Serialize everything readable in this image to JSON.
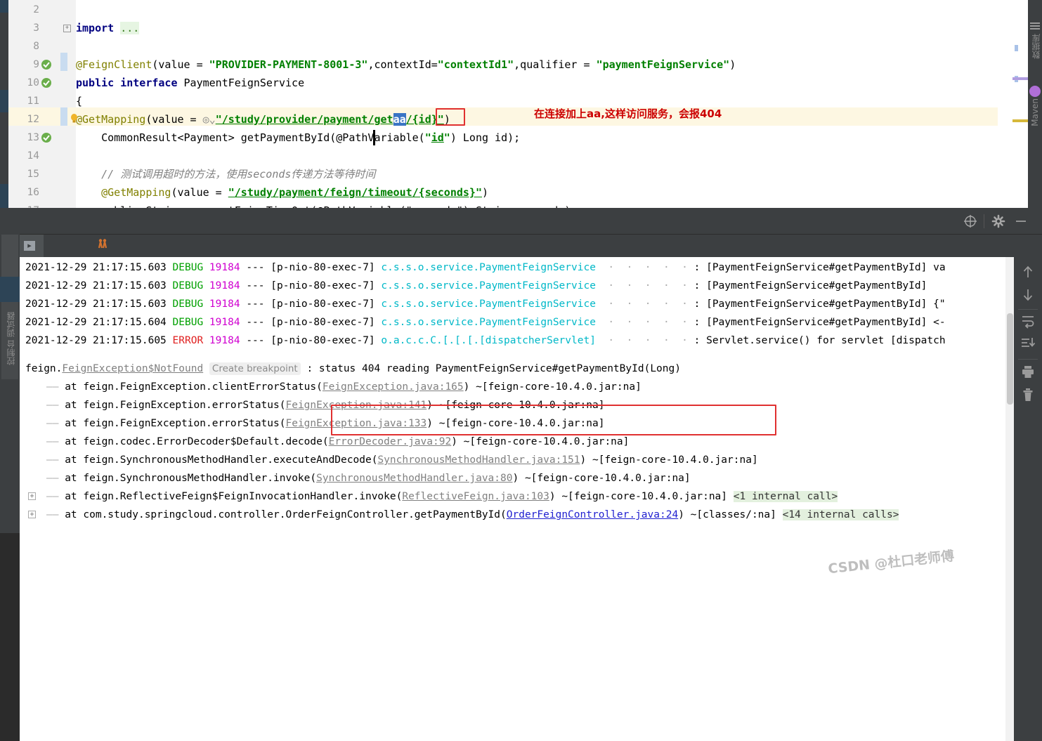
{
  "editor": {
    "lines": [
      {
        "num": "2",
        "segments": []
      },
      {
        "num": "3",
        "segments": [
          {
            "t": "import ",
            "c": "kw"
          },
          {
            "t": "...",
            "c": "fold"
          }
        ]
      },
      {
        "num": "8",
        "segments": []
      },
      {
        "num": "9",
        "segments": [
          {
            "t": "@FeignClient",
            "c": "ann"
          },
          {
            "t": "(value = ",
            "c": "pln"
          },
          {
            "t": "\"PROVIDER-PAYMENT-8001-3\"",
            "c": "str"
          },
          {
            "t": ",contextId=",
            "c": "pln"
          },
          {
            "t": "\"contextId1\"",
            "c": "str"
          },
          {
            "t": ",qualifier = ",
            "c": "pln"
          },
          {
            "t": "\"paymentFeignService\"",
            "c": "str"
          },
          {
            "t": ")",
            "c": "pln"
          }
        ]
      },
      {
        "num": "10",
        "segments": [
          {
            "t": "public interface ",
            "c": "kw"
          },
          {
            "t": "PaymentFeignService",
            "c": "pln"
          }
        ]
      },
      {
        "num": "11",
        "segments": [
          {
            "t": "{",
            "c": "pln"
          }
        ]
      },
      {
        "num": "12",
        "segments": []
      },
      {
        "num": "13",
        "segments": [
          {
            "t": "    CommonResult<Payment> getPaymentById(@Pa",
            "c": "pln"
          },
          {
            "t": "thVariable",
            "c": "pln"
          },
          {
            "t": "(",
            "c": "pln"
          },
          {
            "t": "\"",
            "c": "str"
          },
          {
            "t": "id",
            "c": "lnk"
          },
          {
            "t": "\"",
            "c": "str"
          },
          {
            "t": ") Long id);",
            "c": "pln"
          }
        ]
      },
      {
        "num": "14",
        "segments": []
      },
      {
        "num": "15",
        "segments": [
          {
            "t": "    // 测试调用超时的方法，使用seconds传递方法等待时间",
            "c": "cmt"
          }
        ]
      },
      {
        "num": "16",
        "segments": [
          {
            "t": "    ",
            "c": "pln"
          },
          {
            "t": "@GetMapping",
            "c": "ann"
          },
          {
            "t": "(value = ",
            "c": "pln"
          },
          {
            "t": "\"/study/payment/feign/timeout/{seconds}\"",
            "c": "lnk"
          },
          {
            "t": ")",
            "c": "pln"
          }
        ]
      },
      {
        "num": "17",
        "segments": [
          {
            "t": "    public String paymentFeignTimeOut(@PathVariable(\"seconds\") String seconds);",
            "c": "pln"
          }
        ]
      }
    ],
    "line12": {
      "prefix": "    @GetMapping(value = ",
      "url_before": "\"/study/provider/payment/get",
      "selected": "aa",
      "url_after": "/{id}\"",
      "suffix": ")"
    },
    "annotation_note": "在连接加上aa,这样访问服务，会报404"
  },
  "toolwindow": {
    "controls": [
      {
        "name": "target-icon",
        "label": "target"
      },
      {
        "name": "settings-gear-icon",
        "label": "settings"
      },
      {
        "name": "minimize-icon",
        "label": "minimize"
      }
    ],
    "tabs": [
      {
        "label": "控制台",
        "icon": "console-icon",
        "active": true
      },
      {
        "label": "端点",
        "icon": "endpoints-icon",
        "active": false
      }
    ],
    "left_vertical_labels": [
      "调试器",
      "控制台"
    ],
    "right_icons": [
      {
        "name": "arrow-up-icon",
        "label": "up"
      },
      {
        "name": "arrow-down-icon",
        "label": "down"
      },
      {
        "name": "soft-wrap-icon",
        "label": "soft-wrap"
      },
      {
        "name": "scroll-to-end-icon",
        "label": "scroll-to-end"
      },
      {
        "name": "print-icon",
        "label": "print"
      },
      {
        "name": "trash-icon",
        "label": "delete"
      }
    ]
  },
  "console": {
    "log_lines": [
      {
        "ts": "2021-12-29 21:17:15.603",
        "level": "DEBUG",
        "pid": "19184",
        "dashes": "---",
        "thread": "[p-nio-80-exec-7]",
        "logger": "c.s.s.o.service.PaymentFeignService",
        "msg": ": [PaymentFeignService#getPaymentById] va"
      },
      {
        "ts": "2021-12-29 21:17:15.603",
        "level": "DEBUG",
        "pid": "19184",
        "dashes": "---",
        "thread": "[p-nio-80-exec-7]",
        "logger": "c.s.s.o.service.PaymentFeignService",
        "msg": ": [PaymentFeignService#getPaymentById]"
      },
      {
        "ts": "2021-12-29 21:17:15.603",
        "level": "DEBUG",
        "pid": "19184",
        "dashes": "---",
        "thread": "[p-nio-80-exec-7]",
        "logger": "c.s.s.o.service.PaymentFeignService",
        "msg": ": [PaymentFeignService#getPaymentById] {\""
      },
      {
        "ts": "2021-12-29 21:17:15.604",
        "level": "DEBUG",
        "pid": "19184",
        "dashes": "---",
        "thread": "[p-nio-80-exec-7]",
        "logger": "c.s.s.o.service.PaymentFeignService",
        "msg": ": [PaymentFeignService#getPaymentById] <-"
      },
      {
        "ts": "2021-12-29 21:17:15.605",
        "level": "ERROR",
        "pid": "19184",
        "dashes": "---",
        "thread": "[p-nio-80-exec-7]",
        "logger": "o.a.c.c.C.[.[.[.[dispatcherServlet]",
        "msg": ": Servlet.service() for servlet [dispatch"
      }
    ],
    "exception": {
      "prefix": "feign.",
      "class": "FeignException$NotFound",
      "breakpoint_label": "Create breakpoint",
      "message": ": status 404 reading PaymentFeignService#getPaymentById(Long)"
    },
    "stack": [
      {
        "dash": "——",
        "text": "at feign.FeignException.clientErrorStatus(",
        "link": "FeignException.java:165",
        "link_style": "gray",
        "tail": ") ~[feign-core-10.4.0.jar:na]",
        "internal": ""
      },
      {
        "dash": "——",
        "text": "at feign.FeignException.errorStatus(",
        "link": "FeignException.java:141",
        "link_style": "gray",
        "tail": ") ~[feign-core-10.4.0.jar:na]",
        "internal": ""
      },
      {
        "dash": "——",
        "text": "at feign.FeignException.errorStatus(",
        "link": "FeignException.java:133",
        "link_style": "gray",
        "tail": ") ~[feign-core-10.4.0.jar:na]",
        "internal": ""
      },
      {
        "dash": "——",
        "text": "at feign.codec.ErrorDecoder$Default.decode(",
        "link": "ErrorDecoder.java:92",
        "link_style": "gray",
        "tail": ") ~[feign-core-10.4.0.jar:na]",
        "internal": ""
      },
      {
        "dash": "——",
        "text": "at feign.SynchronousMethodHandler.executeAndDecode(",
        "link": "SynchronousMethodHandler.java:151",
        "link_style": "gray",
        "tail": ") ~[feign-core-10.4.0.jar:na]",
        "internal": ""
      },
      {
        "dash": "——",
        "text": "at feign.SynchronousMethodHandler.invoke(",
        "link": "SynchronousMethodHandler.java:80",
        "link_style": "gray",
        "tail": ") ~[feign-core-10.4.0.jar:na]",
        "internal": ""
      },
      {
        "dash": "——",
        "text": "at feign.ReflectiveFeign$FeignInvocationHandler.invoke(",
        "link": "ReflectiveFeign.java:103",
        "link_style": "gray",
        "tail": ") ~[feign-core-10.4.0.jar:na] ",
        "internal": "<1 internal call>",
        "fold": true
      },
      {
        "dash": "——",
        "text": "at com.study.springcloud.controller.OrderFeignController.getPaymentById(",
        "link": "OrderFeignController.java:24",
        "link_style": "blue",
        "tail": ") ~[classes/:na] ",
        "internal": "<14 internal calls>",
        "fold": true
      }
    ]
  },
  "watermark": "CSDN @杜口老师傅",
  "colors": {
    "accent_red": "#e03030",
    "error": "#e02020",
    "debug": "#00a000",
    "logger": "#00b8c8",
    "pid": "#d000d0",
    "ide_chrome": "#3c3f41"
  }
}
